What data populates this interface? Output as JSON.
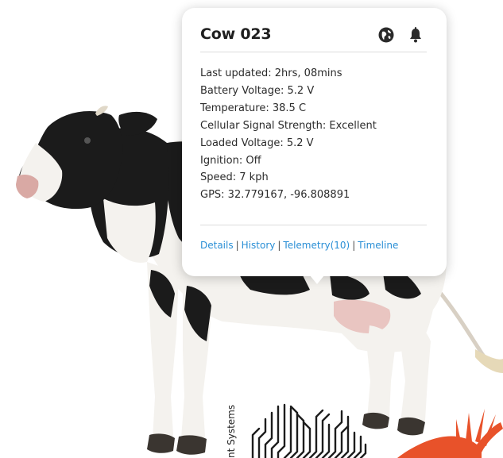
{
  "popup": {
    "title": "Cow 023",
    "icons": {
      "globe": "globe-icon",
      "bell": "bell-icon"
    },
    "details": [
      "Last updated: 2hrs, 08mins",
      "Battery Voltage: 5.2 V",
      "Temperature: 38.5 C",
      "Cellular Signal Strength: Excellent",
      "Loaded Voltage: 5.2 V",
      "Ignition: Off",
      "Speed: 7 kph",
      "GPS: 32.779167, -96.808891"
    ],
    "links": [
      "Details",
      "History",
      "Telemetry(10)",
      "Timeline"
    ],
    "link_separator": "|"
  },
  "branding": {
    "vertical_text": "nt Systems"
  },
  "colors": {
    "link": "#2a8fd6",
    "logo_orange": "#e8522a",
    "text": "#2b2b2b"
  }
}
